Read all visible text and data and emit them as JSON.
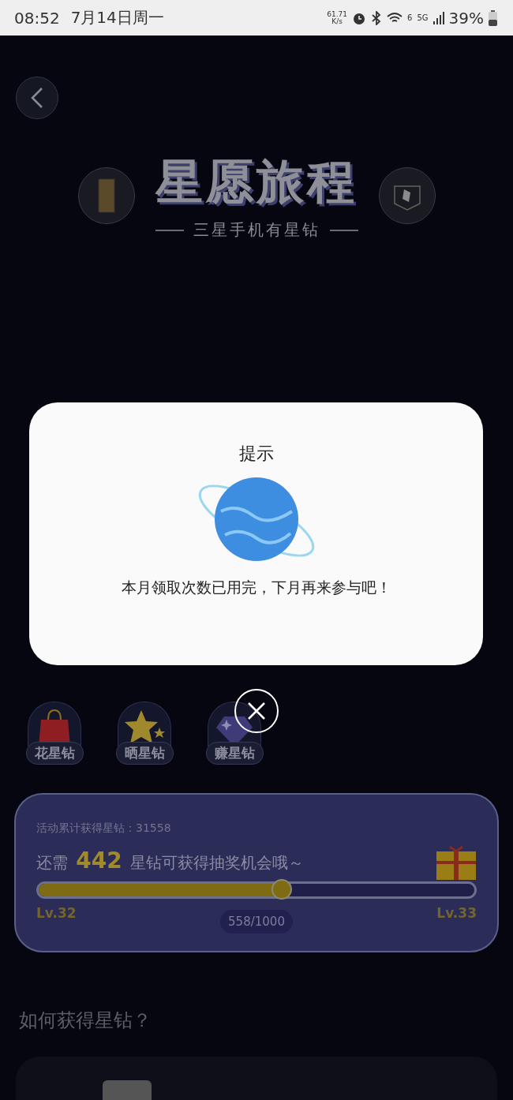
{
  "status_bar": {
    "time": "08:52",
    "date": "7月14日周一",
    "speed_value": "61.71",
    "speed_unit": "K/s",
    "wifi_label": "6",
    "network_label": "5G",
    "battery": "39%"
  },
  "header": {
    "title": "星愿旅程",
    "subtitle": "三星手机有星钻"
  },
  "actions": [
    {
      "label": "花星钻",
      "kind": "bag"
    },
    {
      "label": "晒星钻",
      "kind": "star"
    },
    {
      "label": "赚星钻",
      "kind": "diamond"
    }
  ],
  "progress": {
    "total_label": "活动累计获得星钻：31558",
    "message": "还需 **442** 星钻可获得抽奖机会哦～",
    "level": 0.558,
    "current_level": "Lv.32",
    "next_level": "Lv.33",
    "reading": "558/1000"
  },
  "section": {
    "title": "如何获得星钻？"
  },
  "dialog": {
    "title": "提示",
    "message": "本月领取次数已用完，下月再来参与吧！"
  }
}
